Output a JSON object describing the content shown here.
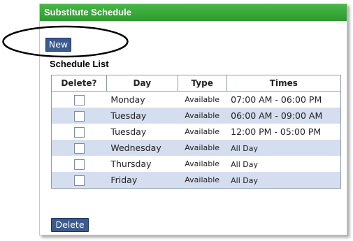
{
  "panel": {
    "title": "Substitute Schedule"
  },
  "toolbar": {
    "new_label": "New"
  },
  "schedule": {
    "title": "Schedule List",
    "columns": [
      "Delete?",
      "Day",
      "Type",
      "Times"
    ],
    "rows": [
      {
        "day": "Monday",
        "type": "Available",
        "times": "07:00 AM - 06:00 PM"
      },
      {
        "day": "Tuesday",
        "type": "Available",
        "times": "06:00 AM - 09:00 AM"
      },
      {
        "day": "Tuesday",
        "type": "Available",
        "times": "12:00 PM - 05:00 PM"
      },
      {
        "day": "Wednesday",
        "type": "Available",
        "times": "All Day"
      },
      {
        "day": "Thursday",
        "type": "Available",
        "times": "All Day"
      },
      {
        "day": "Friday",
        "type": "Available",
        "times": "All Day"
      }
    ]
  },
  "footer": {
    "delete_label": "Delete"
  },
  "colors": {
    "header_green": "#2c9a2c",
    "button_blue": "#3b5a8e",
    "row_alt": "#d5deef",
    "annotation": "#000000"
  }
}
